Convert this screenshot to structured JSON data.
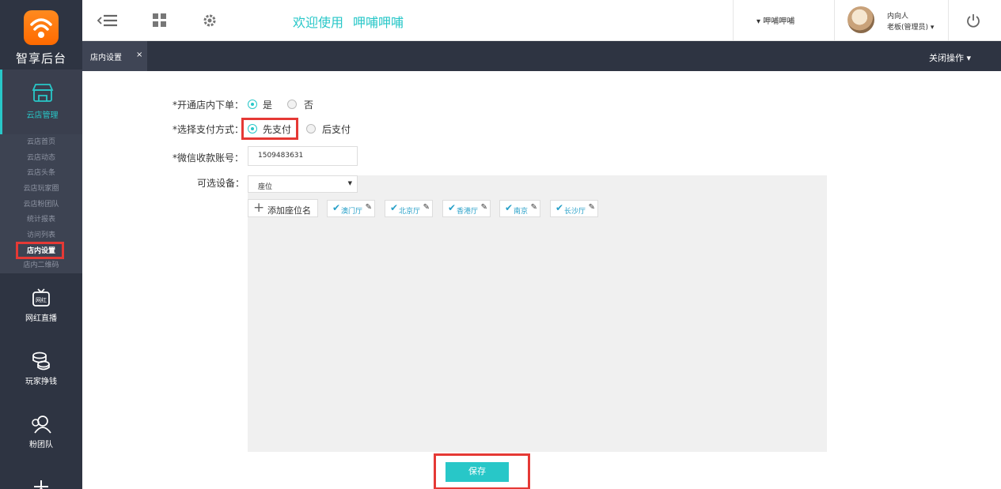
{
  "sidebar": {
    "logo_text": "智享后台",
    "active_section": "云店管理",
    "sub_items": [
      "云店首页",
      "云店动态",
      "云店头条",
      "云店玩家圈",
      "云店粉团队",
      "统计报表",
      "访问列表",
      "店内设置",
      "店内二维码"
    ],
    "active_sub": "店内设置",
    "sections": [
      "网红直播",
      "玩家挣钱",
      "粉团队"
    ],
    "partial_section_icon": "pin-icon"
  },
  "topbar": {
    "welcome": "欢迎使用",
    "shop_name": "呷哺呷哺",
    "shop_select": "▾ 呷哺呷哺",
    "user_name": "内向人",
    "user_role": "老板(管理员) ▾"
  },
  "tabs": {
    "active_label": "店内设置",
    "close_mark": "×",
    "close_ops": "关闭操作 ▾"
  },
  "form": {
    "order_label": "*开通店内下单：",
    "order_yes": "是",
    "order_no": "否",
    "pay_label": "*选择支付方式：",
    "pay_first": "先支付",
    "pay_after": "后支付",
    "wechat_label": "*微信收款账号：",
    "wechat_value": "1509483631",
    "equip_label": "可选设备：",
    "equip_select": "座位",
    "add_seat": "添加座位名",
    "seats": [
      "澳门厅",
      "北京厅",
      "香港厅",
      "南京",
      "长沙厅"
    ],
    "save": "保存"
  },
  "colors": {
    "accent": "#28c7c8",
    "sidebar_bg": "#2e3442",
    "highlight": "#e53935"
  }
}
